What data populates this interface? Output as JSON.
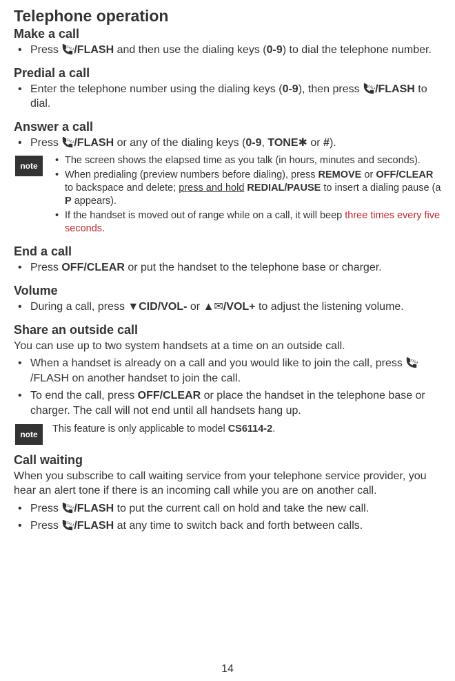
{
  "title": "Telephone operation",
  "pageNumber": "14",
  "noteLabel": "note",
  "icons": {
    "talk": "TALK"
  },
  "sections": {
    "makeCall": {
      "heading": "Make a call",
      "item_prefix": "Press ",
      "flash": "/FLASH",
      "item_mid": " and then use the dialing keys (",
      "range": "0-9",
      "item_suffix": ") to dial the telephone number."
    },
    "predial": {
      "heading": "Predial a call",
      "item_prefix": "Enter the telephone number using the dialing keys (",
      "range": "0-9",
      "item_mid": "), then press ",
      "flash": "/FLASH",
      "item_suffix": " to dial."
    },
    "answer": {
      "heading": "Answer a call",
      "item_prefix": "Press ",
      "flash": "/FLASH",
      "item_mid": " or any of the dialing keys (",
      "range": "0-9",
      "comma": ", ",
      "tone": "TONE",
      "star": "✱",
      "or": " or ",
      "hash": "#",
      "close": ").",
      "notes": {
        "n1": "The screen shows the elapsed time as you talk (in hours, minutes and seconds).",
        "n2_pre": "When predialing (preview numbers before dialing), press ",
        "n2_remove": "REMOVE",
        "n2_or": " or ",
        "n2_off": "OFF",
        "n2_clear": "/CLEAR",
        "n2_mid": " to backspace and delete; ",
        "n2_hold": "press and hold",
        "n2_sp": " ",
        "n2_redial": "REDIAL",
        "n2_pause": "/PAUSE",
        "n2_mid2": " to insert a dialing pause (a ",
        "n2_p": "P",
        "n2_end": " appears).",
        "n3_pre": "If the handset is moved out of range while on a call, it will beep ",
        "n3_red": "three times every five seconds",
        "n3_end": "."
      }
    },
    "end": {
      "heading": "End a call",
      "item_prefix": "Press ",
      "off": "OFF/",
      "clear": "CLEAR",
      "item_suffix": " or put the handset to the telephone base or charger."
    },
    "volume": {
      "heading": "Volume",
      "item_prefix": "During a call, press ",
      "down": "▼",
      "cid": "CID/",
      "volminus": "VOL-",
      "or": " or ",
      "up": "▲",
      "env": "✉",
      "slash": "/",
      "volplus": "VOL+",
      "item_suffix": " to adjust the listening volume."
    },
    "share": {
      "heading": "Share an outside call",
      "intro": "You can use up to two system handsets at a time on an outside call.",
      "i1_pre": "When a handset is already on a call and you would like to join the call, press ",
      "i1_flash": "/FLASH",
      "i1_post": " on another handset to join the call.",
      "i2_pre": "To end the call, press ",
      "i2_off": "OFF/",
      "i2_clear": "CLEAR",
      "i2_post": " or place the handset in the telephone base or charger. The call will not end until all handsets hang up.",
      "note_pre": "This feature is only applicable to model ",
      "note_model": "CS6114-2",
      "note_end": "."
    },
    "callwaiting": {
      "heading": "Call waiting",
      "intro": "When you subscribe to call waiting service from your telephone service provider, you hear an alert tone if there is an incoming call while you are on another call.",
      "i1_pre": "Press ",
      "i1_flash": "/FLASH",
      "i1_post": " to put the current call on hold and take the new call.",
      "i2_pre": "Press ",
      "i2_flash": "/FLASH",
      "i2_post": " at any time to switch back and forth between calls."
    }
  }
}
